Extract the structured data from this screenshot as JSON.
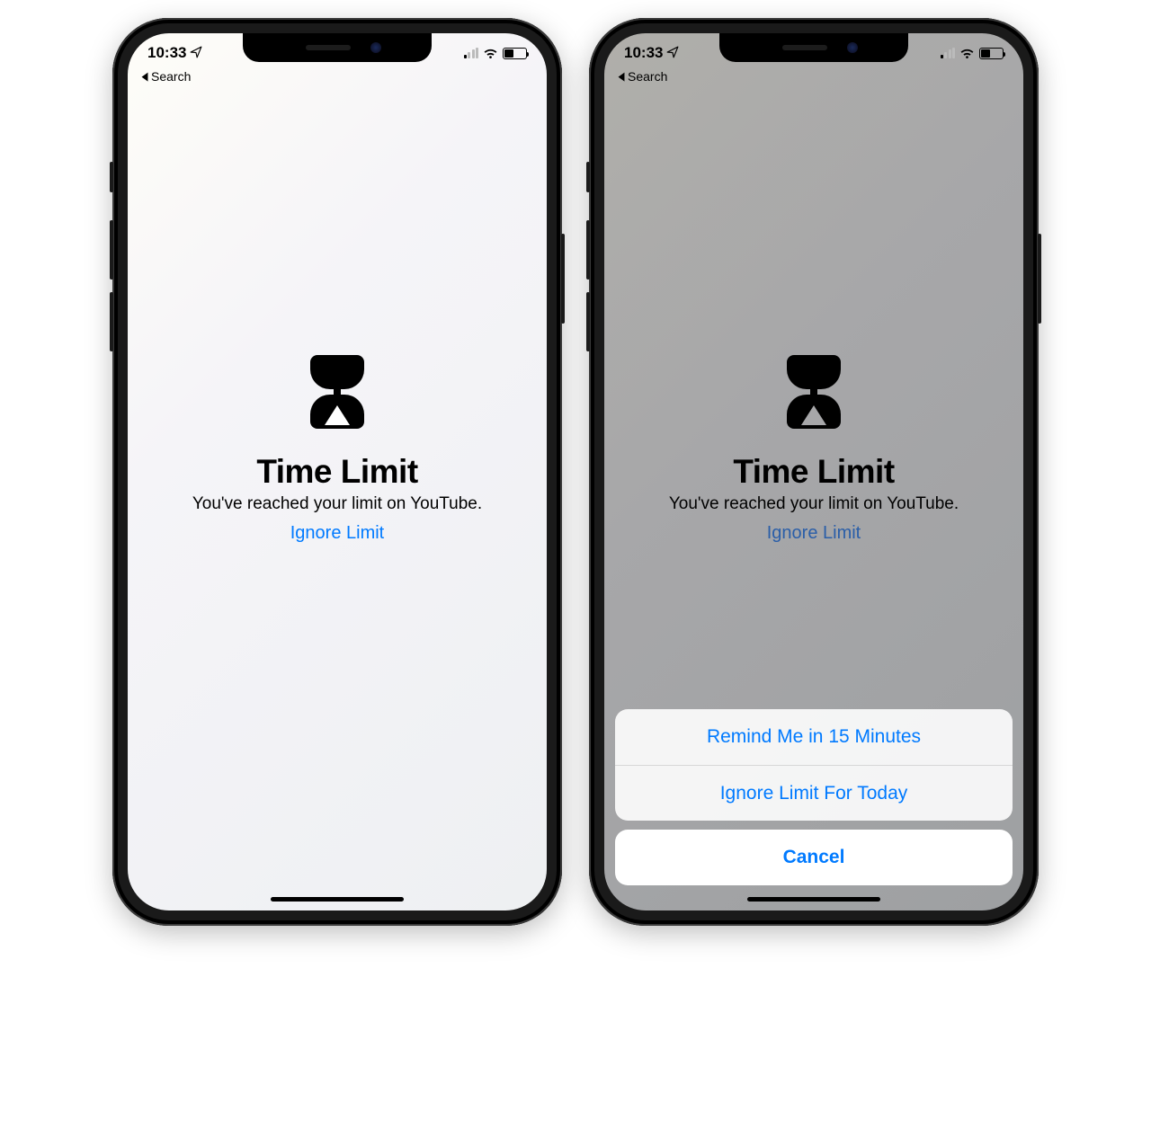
{
  "status": {
    "time": "10:33",
    "back_label": "Search"
  },
  "content": {
    "title": "Time Limit",
    "subtitle": "You've reached your limit on YouTube.",
    "ignore_label": "Ignore Limit"
  },
  "action_sheet": {
    "option1": "Remind Me in 15 Minutes",
    "option2": "Ignore Limit For Today",
    "cancel": "Cancel"
  }
}
